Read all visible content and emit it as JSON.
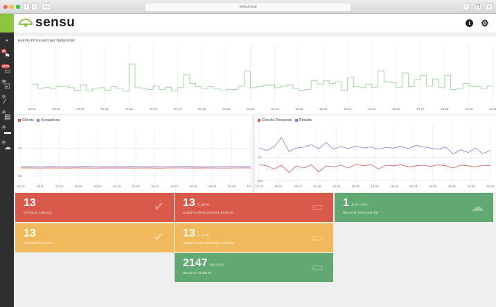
{
  "browser": {
    "url": "sensu.local"
  },
  "header": {
    "logo": "sensu",
    "info_icon": "info-icon",
    "settings_icon": "gear-icon"
  },
  "sidebar": {
    "items": [
      {
        "icon": "dashboard-icon",
        "badge": ""
      },
      {
        "icon": "events-icon",
        "badge": "26",
        "badge_color": "#d9534f"
      },
      {
        "icon": "clients-icon",
        "badge": "2175",
        "badge_color": "#d9534f"
      },
      {
        "icon": "checks-icon",
        "badge": "15",
        "badge_color": "#555"
      },
      {
        "icon": "silenced-icon",
        "badge": "0",
        "badge_color": "#555"
      },
      {
        "icon": "aggregates-icon",
        "badge": "2",
        "badge_color": "#555"
      },
      {
        "icon": "stashes-icon",
        "badge": "2",
        "badge_color": "#555"
      },
      {
        "icon": "datacenters-icon",
        "badge": "1",
        "badge_color": "#555"
      }
    ]
  },
  "chart_data": [
    {
      "type": "line",
      "title": "Events Processed per Datacenter",
      "x_ticks": [
        "16:11",
        "16:12",
        "16:13",
        "16:14",
        "16:15",
        "16:16",
        "16:17",
        "16:18",
        "16:19",
        "16:20",
        "16:21",
        "16:22",
        "16:23",
        "16:24",
        "16:25",
        "16:26",
        "16:27",
        "16:28",
        "16:29",
        "16:30"
      ],
      "series": [
        {
          "color": "#8fd18a",
          "values": [
            40,
            30,
            32,
            30,
            34,
            36,
            32,
            26,
            38,
            25,
            30,
            32,
            26,
            34,
            30,
            24,
            86,
            32,
            30,
            28,
            36,
            28,
            33,
            24,
            32,
            62,
            42,
            34,
            30,
            34,
            30,
            25,
            28,
            28,
            36,
            70,
            32,
            34,
            38,
            38,
            32,
            36,
            38,
            30,
            26,
            28,
            48,
            40,
            48,
            42,
            46,
            26,
            56,
            34,
            32,
            40,
            32,
            70,
            46,
            44,
            32,
            66,
            34,
            50,
            60,
            36,
            52,
            32,
            60,
            28,
            30,
            42,
            36,
            34,
            30,
            36
          ]
        }
      ]
    },
    {
      "type": "line",
      "x_ticks": [
        "16:10",
        "16:11",
        "16:13",
        "16:15",
        "16:16",
        "16:18",
        "16:20",
        "16:21",
        "16:23",
        "16:25",
        "16:26",
        "16:28",
        "16:30"
      ],
      "y_ticks": [
        "4K",
        "2K"
      ],
      "series": [
        {
          "name": "Clients",
          "color": "#d9534f",
          "values": [
            2000,
            2010,
            1990,
            2005,
            2000,
            1995,
            2010,
            2000,
            1990,
            2005,
            2000,
            2010,
            1995,
            2000,
            2005,
            1990,
            2000,
            2010,
            2000,
            1995,
            2005,
            2000,
            1990,
            2000,
            2010,
            2000
          ]
        },
        {
          "name": "Keepalives",
          "color": "#6f86d6",
          "values": [
            2150,
            2170,
            2140,
            2200,
            2160,
            2180,
            2150,
            2210,
            2170,
            2160,
            2190,
            2150,
            2200,
            2170,
            2160,
            2180,
            2150,
            2190,
            2200,
            2170,
            2150,
            2180,
            2160,
            2190,
            2170,
            2180
          ]
        }
      ]
    },
    {
      "type": "line",
      "x_ticks": [
        "16:10",
        "16:11",
        "16:13",
        "16:15",
        "16:16",
        "16:18",
        "16:20",
        "16:21",
        "16:23",
        "16:25",
        "16:26",
        "16:28",
        "16:30"
      ],
      "y_ticks": [
        "1K",
        "500"
      ],
      "series": [
        {
          "name": "Checks Requests",
          "color": "#d9534f",
          "values": [
            660,
            640,
            580,
            650,
            520,
            640,
            600,
            660,
            530,
            640,
            620,
            650,
            600,
            670,
            640,
            660,
            580,
            650,
            640,
            660,
            620,
            640,
            650,
            630,
            660,
            640,
            600,
            650,
            640,
            620,
            650,
            640
          ]
        },
        {
          "name": "Results",
          "color": "#6f86d6",
          "values": [
            960,
            920,
            980,
            1150,
            900,
            960,
            980,
            1020,
            950,
            1060,
            940,
            990,
            950,
            1000,
            960,
            980,
            940,
            970,
            960,
            990,
            950,
            1010,
            980,
            960,
            940,
            980,
            850,
            930,
            880,
            960,
            860,
            920
          ]
        }
      ]
    }
  ],
  "tiles": [
    {
      "value": "13",
      "pct": "",
      "label": "Critical Checks",
      "color": "#d9594b",
      "icon": "check-icon"
    },
    {
      "value": "13",
      "pct": "0.60%",
      "label": "Clients with critical events",
      "color": "#d9594b",
      "icon": "server-icon"
    },
    {
      "value": "1",
      "pct": "100.00%",
      "label": "Healthy datacenter",
      "color": "#62a872",
      "icon": "cloud-icon"
    },
    {
      "value": "13",
      "pct": "",
      "label": "Warning Checks",
      "color": "#f0ba5c",
      "icon": "check-icon"
    },
    {
      "value": "13",
      "pct": "0.60%",
      "label": "Clients with warning events",
      "color": "#f0ba5c",
      "icon": "server-icon"
    },
    {
      "value": "2147",
      "pct": "98.80%",
      "label": "Healthy clients",
      "color": "#62a872",
      "icon": "server-icon"
    }
  ]
}
